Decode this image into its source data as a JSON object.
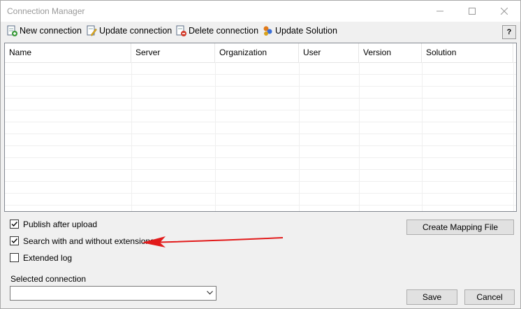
{
  "window": {
    "title": "Connection Manager",
    "minimize": "—",
    "maximize": "☐",
    "close": "✕"
  },
  "toolbar": {
    "new_label": "New connection",
    "update_label": "Update connection",
    "delete_label": "Delete connection",
    "solution_label": "Update Solution",
    "help_label": "?"
  },
  "grid": {
    "columns": [
      "Name",
      "Server",
      "Organization",
      "User",
      "Version",
      "Solution"
    ],
    "rows": []
  },
  "options": {
    "publish_after_upload": {
      "label": "Publish after upload",
      "checked": true
    },
    "search_extensions": {
      "label": "Search with and without extensions",
      "checked": true
    },
    "extended_log": {
      "label": "Extended log",
      "checked": false
    }
  },
  "buttons": {
    "create_mapping": "Create Mapping File",
    "save": "Save",
    "cancel": "Cancel"
  },
  "selected_connection": {
    "label": "Selected connection",
    "value": ""
  },
  "annotation": {
    "arrow_color": "#e21b1b"
  }
}
